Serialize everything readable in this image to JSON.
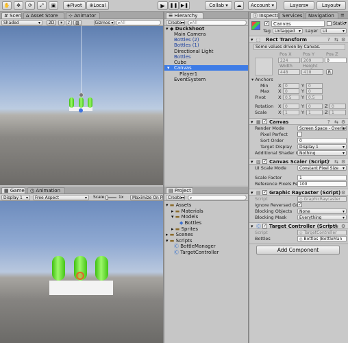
{
  "toolbar": {
    "pivot": "Pivot",
    "local": "Local",
    "collab": "Collab ▾",
    "account": "Account ▾",
    "layers": "Layers",
    "layout": "Layout"
  },
  "scene": {
    "tabs": [
      "Scene",
      "Asset Store",
      "Animator"
    ],
    "shaded": "Shaded",
    "mode2d": "2D",
    "gizmos": "Gizmos ▾",
    "search_placeholder": "All"
  },
  "hierarchy": {
    "tab": "Hierarchy",
    "create": "Create ▾",
    "search_placeholder": "All",
    "root": "DuckShoot",
    "items": [
      {
        "label": "Main Camera",
        "color": "#111111"
      },
      {
        "label": "Bottles (2)",
        "color": "#1a3f9e"
      },
      {
        "label": "Bottles (1)",
        "color": "#1a3f9e"
      },
      {
        "label": "Directional Light",
        "color": "#111111"
      },
      {
        "label": "Bottles",
        "color": "#1a3f9e"
      },
      {
        "label": "Cube",
        "color": "#111111"
      },
      {
        "label": "Canvas",
        "color": "#ffffff"
      },
      {
        "label": "Player1",
        "color": "#111111"
      },
      {
        "label": "EventSystem",
        "color": "#111111"
      }
    ]
  },
  "game": {
    "tabs": [
      "Game",
      "Animation"
    ],
    "display": "Display 1",
    "aspect": "Free Aspect",
    "scale_label": "Scale",
    "scale_value": "1x",
    "maximize": "Maximize On Pla"
  },
  "project": {
    "tab": "Project",
    "create": "Create ▾",
    "items": [
      "Assets",
      "Materials",
      "Models",
      "Bottles",
      "Sprites",
      "Scenes",
      "Scripts",
      "BottleManager",
      "TargetController"
    ]
  },
  "inspector": {
    "tabs": [
      "Inspector",
      "Services",
      "Navigation"
    ],
    "object_name": "Canvas",
    "static": "Static",
    "tag_label": "Tag",
    "tag": "Untagged",
    "layer_label": "Layer",
    "layer": "UI",
    "rect": {
      "title": "Rect Transform",
      "note": "Some values driven by Canvas.",
      "pos_x": "Pos X",
      "pos_y": "Pos Y",
      "pos_z": "Pos Z",
      "px": "224",
      "py": "209",
      "pz": "0",
      "width_l": "Width",
      "height_l": "Height",
      "w": "448",
      "h": "418",
      "r": "R",
      "anchors": "Anchors",
      "min": "Min",
      "max": "Max",
      "pivot": "Pivot",
      "rotation": "Rotation",
      "scale": "Scale",
      "minx": "0",
      "miny": "0",
      "maxx": "0",
      "maxy": "0",
      "pivx": "0.5",
      "pivy": "0.5",
      "rotx": "0",
      "roty": "0",
      "rotz": "0",
      "scx": "1",
      "scy": "1",
      "scz": "1",
      "x": "X",
      "y": "Y",
      "z": "Z"
    },
    "canvas": {
      "title": "Canvas",
      "render_mode_l": "Render Mode",
      "render_mode": "Screen Space - Overlay",
      "pixel_perfect": "Pixel Perfect",
      "sort_order_l": "Sort Order",
      "sort_order": "0",
      "target_display_l": "Target Display",
      "target_display": "Display 1",
      "shader_l": "Additional Shader Cl",
      "shader": "Nothing"
    },
    "scaler": {
      "title": "Canvas Scaler (Script)",
      "ui_scale_l": "UI Scale Mode",
      "ui_scale": "Constant Pixel Size",
      "scale_factor_l": "Scale Factor",
      "scale_factor": "1",
      "ref_px_l": "Reference Pixels Per",
      "ref_px": "100"
    },
    "raycaster": {
      "title": "Graphic Raycaster (Script)",
      "script_l": "Script",
      "script": "GraphicRaycaster",
      "ignore_l": "Ignore Reversed Gra",
      "blocking_l": "Blocking Objects",
      "blocking": "None",
      "mask_l": "Blocking Mask",
      "mask": "Everything"
    },
    "target": {
      "title": "Target Controller (Script)",
      "script_l": "Script",
      "script": "TargetController",
      "bottles_l": "Bottles",
      "bottles": "Bottles (BottleMan"
    },
    "add_component": "Add Component"
  }
}
